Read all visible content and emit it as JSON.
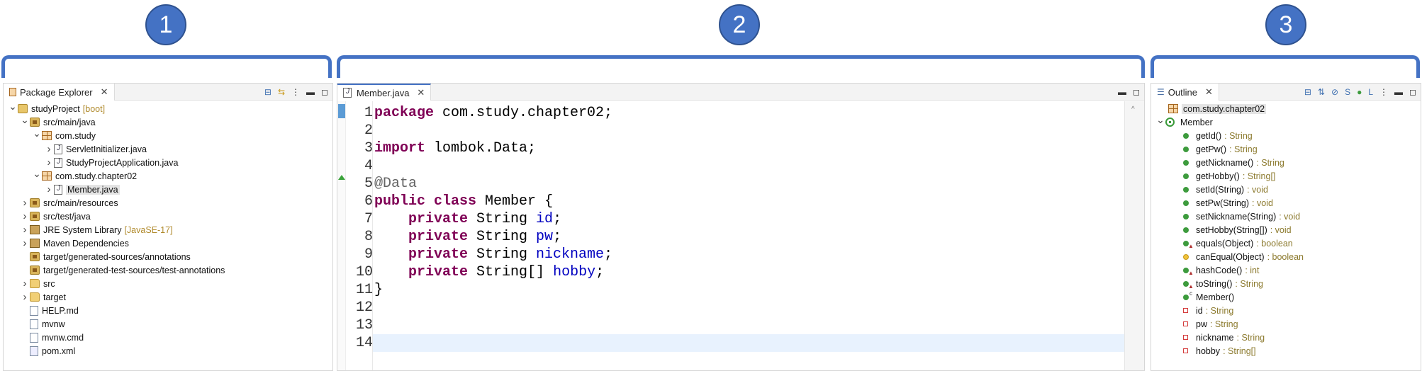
{
  "callouts": [
    "1",
    "2",
    "3"
  ],
  "package_explorer": {
    "tab_title": "Package Explorer",
    "tab_icon": "package-explorer-icon",
    "toolbar": [
      "collapse-all-icon",
      "link-with-editor-icon",
      "view-menu-icon",
      "minimize-icon",
      "maximize-icon"
    ],
    "rows": [
      {
        "label": "studyProject",
        "decoration": "[boot]",
        "icon": "project-icon",
        "twisty": "open"
      },
      {
        "label": "src/main/java",
        "icon": "source-folder-icon",
        "twisty": "open"
      },
      {
        "label": "com.study",
        "icon": "package-icon",
        "twisty": "open"
      },
      {
        "label": "ServletInitializer.java",
        "icon": "java-file-icon",
        "twisty": "closed"
      },
      {
        "label": "StudyProjectApplication.java",
        "icon": "java-file-icon",
        "twisty": "closed"
      },
      {
        "label": "com.study.chapter02",
        "icon": "package-icon",
        "twisty": "open"
      },
      {
        "label": "Member.java",
        "icon": "java-file-icon",
        "twisty": "closed",
        "selected": true
      },
      {
        "label": "src/main/resources",
        "icon": "source-folder-icon",
        "twisty": "closed"
      },
      {
        "label": "src/test/java",
        "icon": "source-folder-icon",
        "twisty": "closed"
      },
      {
        "label": "JRE System Library",
        "decoration": "[JavaSE-17]",
        "icon": "library-icon",
        "twisty": "closed"
      },
      {
        "label": "Maven Dependencies",
        "icon": "library-icon",
        "twisty": "closed"
      },
      {
        "label": "target/generated-sources/annotations",
        "icon": "source-folder-icon",
        "twisty": "none"
      },
      {
        "label": "target/generated-test-sources/test-annotations",
        "icon": "source-folder-icon",
        "twisty": "none"
      },
      {
        "label": "src",
        "icon": "folder-icon",
        "twisty": "closed"
      },
      {
        "label": "target",
        "icon": "folder-icon",
        "twisty": "closed"
      },
      {
        "label": "HELP.md",
        "icon": "file-icon",
        "twisty": "none"
      },
      {
        "label": "mvnw",
        "icon": "file-icon",
        "twisty": "none"
      },
      {
        "label": "mvnw.cmd",
        "icon": "file-icon",
        "twisty": "none"
      },
      {
        "label": "pom.xml",
        "icon": "xml-file-icon",
        "twisty": "none"
      }
    ]
  },
  "editor": {
    "tab_title": "Member.java",
    "toolbar": [
      "minimize-icon",
      "maximize-icon"
    ],
    "current_line": 14,
    "lines": [
      [
        {
          "t": "package",
          "c": "kw"
        },
        {
          "t": " com.study.chapter02;",
          "c": "txt"
        }
      ],
      [],
      [
        {
          "t": "import",
          "c": "kw"
        },
        {
          "t": " lombok.Data;",
          "c": "txt"
        }
      ],
      [],
      [
        {
          "t": "@Data",
          "c": "ann"
        }
      ],
      [
        {
          "t": "public",
          "c": "kw"
        },
        {
          "t": " ",
          "c": "txt"
        },
        {
          "t": "class",
          "c": "kw"
        },
        {
          "t": " Member {",
          "c": "txt"
        }
      ],
      [
        {
          "t": "    ",
          "c": "txt"
        },
        {
          "t": "private",
          "c": "kw"
        },
        {
          "t": " String ",
          "c": "txt"
        },
        {
          "t": "id",
          "c": "fld"
        },
        {
          "t": ";",
          "c": "txt"
        }
      ],
      [
        {
          "t": "    ",
          "c": "txt"
        },
        {
          "t": "private",
          "c": "kw"
        },
        {
          "t": " String ",
          "c": "txt"
        },
        {
          "t": "pw",
          "c": "fld"
        },
        {
          "t": ";",
          "c": "txt"
        }
      ],
      [
        {
          "t": "    ",
          "c": "txt"
        },
        {
          "t": "private",
          "c": "kw"
        },
        {
          "t": " String ",
          "c": "txt"
        },
        {
          "t": "nickname",
          "c": "fld"
        },
        {
          "t": ";",
          "c": "txt"
        }
      ],
      [
        {
          "t": "    ",
          "c": "txt"
        },
        {
          "t": "private",
          "c": "kw"
        },
        {
          "t": " String[] ",
          "c": "txt"
        },
        {
          "t": "hobby",
          "c": "fld"
        },
        {
          "t": ";",
          "c": "txt"
        }
      ],
      [
        {
          "t": "}",
          "c": "txt"
        }
      ],
      [],
      [],
      []
    ]
  },
  "outline": {
    "tab_title": "Outline",
    "toolbar": [
      "collapse-all-icon",
      "sort-icon",
      "hide-fields-icon",
      "hide-static-icon",
      "hide-non-public-icon",
      "hide-local-types-icon",
      "view-menu-icon",
      "minimize-icon",
      "maximize-icon"
    ],
    "rows": [
      {
        "label": "com.study.chapter02",
        "icon": "package-icon",
        "kind": "package",
        "selected": true
      },
      {
        "label": "Member",
        "icon": "class-icon",
        "kind": "class"
      },
      {
        "label": "getId()",
        "type": ": String",
        "icon": "public-method-icon",
        "kind": "method"
      },
      {
        "label": "getPw()",
        "type": ": String",
        "icon": "public-method-icon",
        "kind": "method"
      },
      {
        "label": "getNickname()",
        "type": ": String",
        "icon": "public-method-icon",
        "kind": "method"
      },
      {
        "label": "getHobby()",
        "type": ": String[]",
        "icon": "public-method-icon",
        "kind": "method"
      },
      {
        "label": "setId(String)",
        "type": ": void",
        "icon": "public-method-icon",
        "kind": "method"
      },
      {
        "label": "setPw(String)",
        "type": ": void",
        "icon": "public-method-icon",
        "kind": "method"
      },
      {
        "label": "setNickname(String)",
        "type": ": void",
        "icon": "public-method-icon",
        "kind": "method"
      },
      {
        "label": "setHobby(String[])",
        "type": ": void",
        "icon": "public-method-icon",
        "kind": "method"
      },
      {
        "label": "equals(Object)",
        "type": ": boolean",
        "icon": "override-method-icon",
        "kind": "override"
      },
      {
        "label": "canEqual(Object)",
        "type": ": boolean",
        "icon": "protected-method-icon",
        "kind": "protected"
      },
      {
        "label": "hashCode()",
        "type": ": int",
        "icon": "override-method-icon",
        "kind": "override"
      },
      {
        "label": "toString()",
        "type": ": String",
        "icon": "override-method-icon",
        "kind": "override"
      },
      {
        "label": "Member()",
        "icon": "constructor-icon",
        "kind": "constructor"
      },
      {
        "label": "id",
        "type": ": String",
        "icon": "private-field-icon",
        "kind": "field"
      },
      {
        "label": "pw",
        "type": ": String",
        "icon": "private-field-icon",
        "kind": "field"
      },
      {
        "label": "nickname",
        "type": ": String",
        "icon": "private-field-icon",
        "kind": "field"
      },
      {
        "label": "hobby",
        "type": ": String[]",
        "icon": "private-field-icon",
        "kind": "field"
      }
    ]
  },
  "colors": {
    "callout": "#4472c4",
    "keyword": "#7f0055",
    "field": "#0000c0",
    "annotation": "#646464",
    "current_line": "#e8f2fe"
  }
}
